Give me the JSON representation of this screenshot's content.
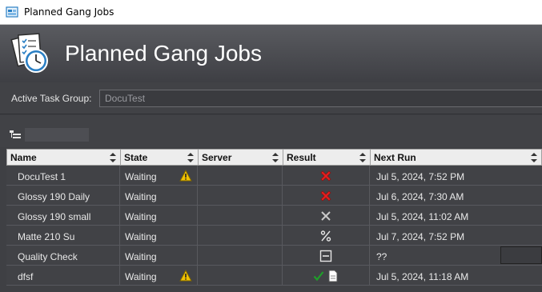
{
  "window": {
    "title": "Planned Gang Jobs"
  },
  "header": {
    "title": "Planned Gang Jobs"
  },
  "task_group": {
    "label": "Active Task Group:",
    "value": "DocuTest"
  },
  "table": {
    "columns": [
      "Name",
      "State",
      "Server",
      "Result",
      "Next Run"
    ],
    "rows": [
      {
        "name": "DocuTest 1",
        "state": "Waiting",
        "warning": true,
        "server": "",
        "result": "error",
        "next_run": "Jul 5, 2024, 7:52 PM"
      },
      {
        "name": "Glossy 190 Daily",
        "state": "Waiting",
        "warning": false,
        "server": "",
        "result": "error",
        "next_run": "Jul 6, 2024, 7:30 AM"
      },
      {
        "name": "Glossy 190 small",
        "state": "Waiting",
        "warning": false,
        "server": "",
        "result": "cancelled",
        "next_run": "Jul 5, 2024, 11:02 AM"
      },
      {
        "name": "Matte 210 Su",
        "state": "Waiting",
        "warning": false,
        "server": "",
        "result": "percent",
        "next_run": "Jul 7, 2024, 7:52 PM"
      },
      {
        "name": "Quality Check",
        "state": "Waiting",
        "warning": false,
        "server": "",
        "result": "minus",
        "next_run": "??"
      },
      {
        "name": "dfsf",
        "state": "Waiting",
        "warning": true,
        "server": "",
        "result": "success-document",
        "next_run": "Jul 5, 2024, 11:18 AM"
      }
    ]
  },
  "colors": {
    "error": "#e02020",
    "success": "#1f9e2a",
    "warning": "#f2c200",
    "background": "#414246"
  }
}
